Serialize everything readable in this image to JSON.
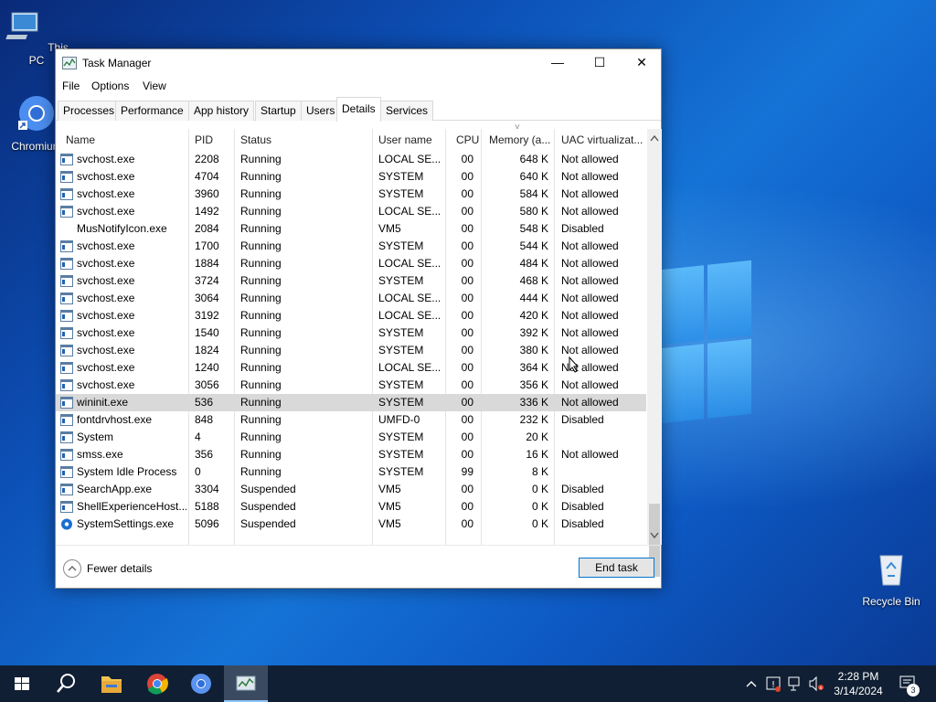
{
  "desktop": {
    "icons": [
      {
        "label": "This PC"
      },
      {
        "label": "Chromium"
      },
      {
        "label": "Recycle Bin"
      }
    ]
  },
  "window": {
    "title": "Task Manager",
    "minimize_label": "—",
    "maximize_label": "☐",
    "close_label": "✕",
    "menu": [
      "File",
      "Options",
      "View"
    ],
    "tabs": [
      "Processes",
      "Performance",
      "App history",
      "Startup",
      "Users",
      "Details",
      "Services"
    ],
    "active_tab": "Details",
    "columns": [
      "Name",
      "PID",
      "Status",
      "User name",
      "CPU",
      "Memory (a...",
      "UAC virtualizat..."
    ],
    "sort_indicator": "˅",
    "rows": [
      {
        "name": "svchost.exe",
        "pid": "2208",
        "status": "Running",
        "user": "LOCAL SE...",
        "cpu": "00",
        "mem": "648 K",
        "uac": "Not allowed",
        "icon": "service-icon"
      },
      {
        "name": "svchost.exe",
        "pid": "4704",
        "status": "Running",
        "user": "SYSTEM",
        "cpu": "00",
        "mem": "640 K",
        "uac": "Not allowed",
        "icon": "service-icon"
      },
      {
        "name": "svchost.exe",
        "pid": "3960",
        "status": "Running",
        "user": "SYSTEM",
        "cpu": "00",
        "mem": "584 K",
        "uac": "Not allowed",
        "icon": "service-icon"
      },
      {
        "name": "svchost.exe",
        "pid": "1492",
        "status": "Running",
        "user": "LOCAL SE...",
        "cpu": "00",
        "mem": "580 K",
        "uac": "Not allowed",
        "icon": "service-icon"
      },
      {
        "name": "MusNotifyIcon.exe",
        "pid": "2084",
        "status": "Running",
        "user": "VM5",
        "cpu": "00",
        "mem": "548 K",
        "uac": "Disabled",
        "icon": ""
      },
      {
        "name": "svchost.exe",
        "pid": "1700",
        "status": "Running",
        "user": "SYSTEM",
        "cpu": "00",
        "mem": "544 K",
        "uac": "Not allowed",
        "icon": "service-icon"
      },
      {
        "name": "svchost.exe",
        "pid": "1884",
        "status": "Running",
        "user": "LOCAL SE...",
        "cpu": "00",
        "mem": "484 K",
        "uac": "Not allowed",
        "icon": "service-icon"
      },
      {
        "name": "svchost.exe",
        "pid": "3724",
        "status": "Running",
        "user": "SYSTEM",
        "cpu": "00",
        "mem": "468 K",
        "uac": "Not allowed",
        "icon": "service-icon"
      },
      {
        "name": "svchost.exe",
        "pid": "3064",
        "status": "Running",
        "user": "LOCAL SE...",
        "cpu": "00",
        "mem": "444 K",
        "uac": "Not allowed",
        "icon": "service-icon"
      },
      {
        "name": "svchost.exe",
        "pid": "3192",
        "status": "Running",
        "user": "LOCAL SE...",
        "cpu": "00",
        "mem": "420 K",
        "uac": "Not allowed",
        "icon": "service-icon"
      },
      {
        "name": "svchost.exe",
        "pid": "1540",
        "status": "Running",
        "user": "SYSTEM",
        "cpu": "00",
        "mem": "392 K",
        "uac": "Not allowed",
        "icon": "service-icon"
      },
      {
        "name": "svchost.exe",
        "pid": "1824",
        "status": "Running",
        "user": "SYSTEM",
        "cpu": "00",
        "mem": "380 K",
        "uac": "Not allowed",
        "icon": "service-icon"
      },
      {
        "name": "svchost.exe",
        "pid": "1240",
        "status": "Running",
        "user": "LOCAL SE...",
        "cpu": "00",
        "mem": "364 K",
        "uac": "Not allowed",
        "icon": "service-icon"
      },
      {
        "name": "svchost.exe",
        "pid": "3056",
        "status": "Running",
        "user": "SYSTEM",
        "cpu": "00",
        "mem": "356 K",
        "uac": "Not allowed",
        "icon": "service-icon"
      },
      {
        "name": "wininit.exe",
        "pid": "536",
        "status": "Running",
        "user": "SYSTEM",
        "cpu": "00",
        "mem": "336 K",
        "uac": "Not allowed",
        "icon": "service-icon",
        "selected": true
      },
      {
        "name": "fontdrvhost.exe",
        "pid": "848",
        "status": "Running",
        "user": "UMFD-0",
        "cpu": "00",
        "mem": "232 K",
        "uac": "Disabled",
        "icon": "service-icon"
      },
      {
        "name": "System",
        "pid": "4",
        "status": "Running",
        "user": "SYSTEM",
        "cpu": "00",
        "mem": "20 K",
        "uac": "",
        "icon": "service-icon"
      },
      {
        "name": "smss.exe",
        "pid": "356",
        "status": "Running",
        "user": "SYSTEM",
        "cpu": "00",
        "mem": "16 K",
        "uac": "Not allowed",
        "icon": "service-icon"
      },
      {
        "name": "System Idle Process",
        "pid": "0",
        "status": "Running",
        "user": "SYSTEM",
        "cpu": "99",
        "mem": "8 K",
        "uac": "",
        "icon": "idle-icon"
      },
      {
        "name": "SearchApp.exe",
        "pid": "3304",
        "status": "Suspended",
        "user": "VM5",
        "cpu": "00",
        "mem": "0 K",
        "uac": "Disabled",
        "icon": "service-icon"
      },
      {
        "name": "ShellExperienceHost....",
        "pid": "5188",
        "status": "Suspended",
        "user": "VM5",
        "cpu": "00",
        "mem": "0 K",
        "uac": "Disabled",
        "icon": "service-icon"
      },
      {
        "name": "SystemSettings.exe",
        "pid": "5096",
        "status": "Suspended",
        "user": "VM5",
        "cpu": "00",
        "mem": "0 K",
        "uac": "Disabled",
        "icon": "settings-gear-icon"
      }
    ],
    "fewer_details": "Fewer details",
    "end_task": "End task"
  },
  "taskbar": {
    "apps": [
      "start-button",
      "search-button",
      "file-explorer-button",
      "chrome-button",
      "chromium-button",
      "task-manager-button"
    ],
    "clock_time": "2:28 PM",
    "clock_date": "3/14/2024",
    "notification_count": "3"
  },
  "colors": {
    "accent": "#0078d7",
    "selected_row": "#d9d9d9",
    "taskbar": "#101f33"
  }
}
